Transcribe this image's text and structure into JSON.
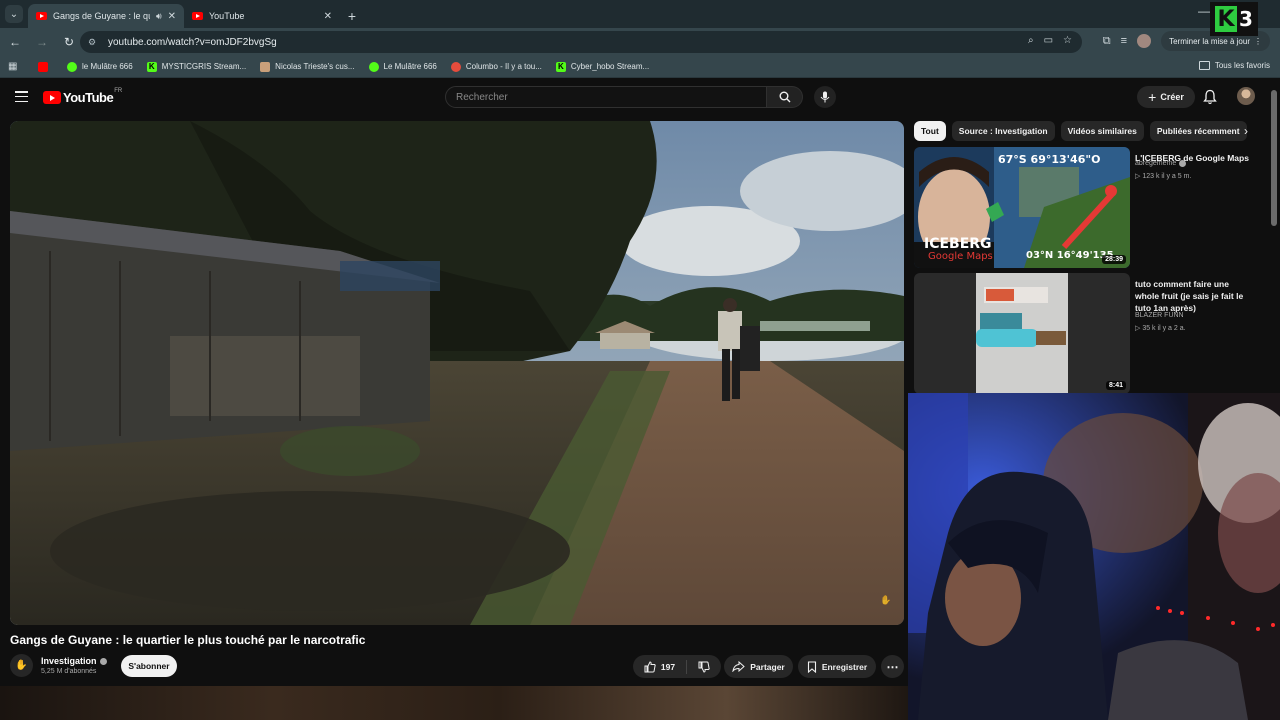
{
  "browser": {
    "tabs": [
      {
        "title": "Gangs de Guyane : le quartier",
        "active": true,
        "audio": true
      },
      {
        "title": "YouTube",
        "active": false,
        "audio": false
      }
    ],
    "url": "youtube.com/watch?v=omJDF2bvgSg",
    "update_label": "Terminer la mise à jour",
    "bookmarks": [
      {
        "label": "",
        "icon": "youtube-icon"
      },
      {
        "label": "le Mulâtre 666",
        "icon": "kick-play-icon"
      },
      {
        "label": "MYSTICGRIS Stream...",
        "icon": "kick-icon"
      },
      {
        "label": "Nicolas Trieste's cus...",
        "icon": "fox-icon"
      },
      {
        "label": "Le Mulâtre 666",
        "icon": "kick-play-icon"
      },
      {
        "label": "Columbo - Il y a tou...",
        "icon": "columbo-icon"
      },
      {
        "label": "Cyber_hobo Stream...",
        "icon": "kick-icon"
      }
    ],
    "all_bookmarks_label": "Tous les favoris"
  },
  "overlay_logo": {
    "letter": "K",
    "number": "3"
  },
  "youtube": {
    "logo_text": "YouTube",
    "logo_region": "FR",
    "search_placeholder": "Rechercher",
    "create_label": "Créer"
  },
  "video": {
    "title": "Gangs de Guyane : le quartier le plus touché par le narcotrafic",
    "channel": "Investigation",
    "subscribers": "5,25 M d'abonnés",
    "subscribe_label": "S'abonner",
    "likes": "197",
    "share_label": "Partager",
    "save_label": "Enregistrer"
  },
  "chips": [
    {
      "label": "Tout",
      "active": true
    },
    {
      "label": "Source : Investigation",
      "active": false
    },
    {
      "label": "Vidéos similaires",
      "active": false
    },
    {
      "label": "Publiées récemment",
      "active": false
    }
  ],
  "recommendations": [
    {
      "title": "L'ICEBERG de Google Maps",
      "channel": "abregememe",
      "verified": true,
      "views": "123 k",
      "age": "il y a 5 m.",
      "duration": "28:39",
      "thumb_text_top": "67°S 69°13'46\"O",
      "thumb_text_main": "ICEBERG",
      "thumb_text_sub": "Google Maps",
      "thumb_text_bottom": "03°N 16°49'135"
    },
    {
      "title": "tuto comment faire une whole fruit (je sais je fait le tuto 1an après)",
      "channel": "BLAZER FUNN",
      "verified": false,
      "views": "35 k",
      "age": "il y a 2 a.",
      "duration": "8:41"
    }
  ],
  "colors": {
    "youtube_red": "#ff0000",
    "kick_green": "#53fc18",
    "background": "#0f0f0f",
    "chrome_toolbar": "#35464c"
  }
}
